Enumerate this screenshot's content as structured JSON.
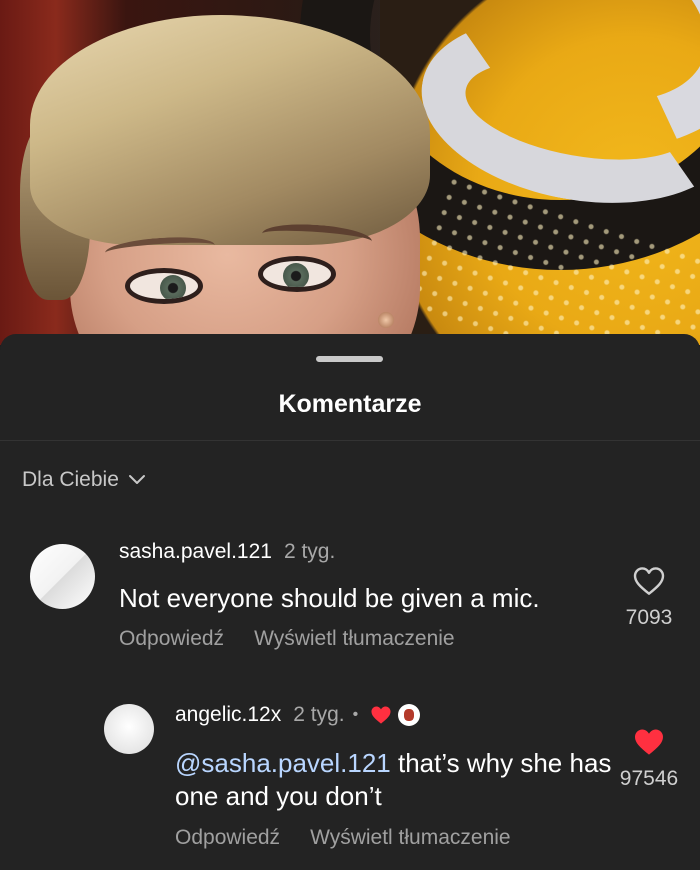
{
  "sheet": {
    "title": "Komentarze",
    "sort_label": "Dla Ciebie"
  },
  "comments": [
    {
      "username": "sasha.pavel.121",
      "time": "2 tyg.",
      "text": "Not everyone should be given a mic.",
      "reply_label": "Odpowiedź",
      "translate_label": "Wyświetl tłumaczenie",
      "likes": "7093",
      "liked": false
    },
    {
      "username": "angelic.12x",
      "time": "2 tyg.",
      "bullet": "•",
      "mention": "@sasha.pavel.121",
      "text": " that’s why she has one and you don’t",
      "reply_label": "Odpowiedź",
      "translate_label": "Wyświetl tłumaczenie",
      "likes": "97546",
      "liked": true
    }
  ],
  "colors": {
    "sheet_bg": "#232323",
    "like_red": "#ff3040",
    "mention": "#b9d6ff"
  }
}
